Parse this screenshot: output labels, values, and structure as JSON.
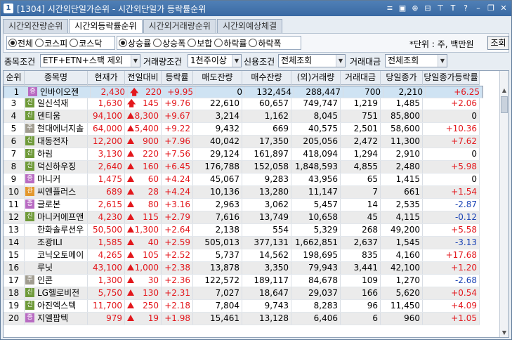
{
  "window": {
    "number": "1",
    "title": "[1304] 시간외단일가순위 - 시간외단일가 등락률순위"
  },
  "title_icons": [
    "menu-icon",
    "screen-icon",
    "zoom-icon",
    "minimize-icon",
    "pin-icon",
    "text-icon",
    "help-icon",
    "window-minimize-icon",
    "restore-icon",
    "close-icon"
  ],
  "tabs": [
    {
      "label": "시간외잔량순위",
      "active": false
    },
    {
      "label": "시간외등락률순위",
      "active": true
    },
    {
      "label": "시간외거래량순위",
      "active": false
    },
    {
      "label": "시간외예상체결",
      "active": false
    }
  ],
  "market_filter": [
    {
      "label": "전체",
      "checked": true
    },
    {
      "label": "코스피",
      "checked": false
    },
    {
      "label": "코스닥",
      "checked": false
    }
  ],
  "rank_filter": [
    {
      "label": "상승률",
      "checked": true
    },
    {
      "label": "상승폭",
      "checked": false
    },
    {
      "label": "보합",
      "checked": false
    },
    {
      "label": "하락률",
      "checked": false
    },
    {
      "label": "하락폭",
      "checked": false
    }
  ],
  "unit_text": "*단위 : 주, 백만원",
  "query_button": "조회",
  "conditions": {
    "item_label": "종목조건",
    "item_value": "ETF+ETN+스팩 제외",
    "volume_label": "거래량조건",
    "volume_value": "1천주이상",
    "credit_label": "신용조건",
    "credit_value": "전체조회",
    "amount_label": "거래대금",
    "amount_value": "전체조회"
  },
  "columns": [
    "순위",
    "종목명",
    "현재가",
    "전일대비",
    "등락률",
    "매도잔량",
    "매수잔량",
    "(외)거래량",
    "거래대금",
    "당일종가",
    "당일종가등락률"
  ],
  "rows": [
    {
      "rank": "1",
      "badge": "증",
      "badge_color": "#b86bc2",
      "name": "인바이오젠",
      "price": "2,430",
      "sign": "arrow",
      "change": "220",
      "rate": "+9.95",
      "ask": "0",
      "bid": "132,454",
      "volume": "288,447",
      "amount": "700",
      "close": "2,210",
      "close_rate": "+6.25"
    },
    {
      "rank": "2",
      "badge": "",
      "badge_color": "",
      "name": "제노포커스",
      "price": "7,020",
      "sign": "arrow",
      "change": "630",
      "rate": "+9.86",
      "ask": "0",
      "bid": "400,511",
      "volume": "48,325",
      "amount": "339",
      "close": "6,390",
      "close_rate": "+5.45"
    },
    {
      "rank": "3",
      "badge": "신",
      "badge_color": "#6f9a3a",
      "name": "일신석재",
      "price": "1,630",
      "sign": "arrow",
      "change": "145",
      "rate": "+9.76",
      "ask": "22,610",
      "bid": "60,657",
      "volume": "749,747",
      "amount": "1,219",
      "close": "1,485",
      "close_rate": "+2.06"
    },
    {
      "rank": "4",
      "badge": "신",
      "badge_color": "#6f9a3a",
      "name": "덴티움",
      "price": "94,100",
      "sign": "tri",
      "change": "8,300",
      "rate": "+9.67",
      "ask": "3,214",
      "bid": "1,162",
      "volume": "8,045",
      "amount": "751",
      "close": "85,800",
      "close_rate": "0"
    },
    {
      "rank": "5",
      "badge": "주",
      "badge_color": "#a09c90",
      "name": "현대에너지솔",
      "price": "64,000",
      "sign": "tri",
      "change": "5,400",
      "rate": "+9.22",
      "ask": "9,432",
      "bid": "669",
      "volume": "40,575",
      "amount": "2,501",
      "close": "58,600",
      "close_rate": "+10.36"
    },
    {
      "rank": "6",
      "badge": "신",
      "badge_color": "#6f9a3a",
      "name": "대동전자",
      "price": "12,200",
      "sign": "tri",
      "change": "900",
      "rate": "+7.96",
      "ask": "40,042",
      "bid": "17,350",
      "volume": "205,056",
      "amount": "2,472",
      "close": "11,300",
      "close_rate": "+7.62"
    },
    {
      "rank": "7",
      "badge": "신",
      "badge_color": "#6f9a3a",
      "name": "하림",
      "price": "3,130",
      "sign": "tri",
      "change": "220",
      "rate": "+7.56",
      "ask": "29,124",
      "bid": "161,897",
      "volume": "418,094",
      "amount": "1,294",
      "close": "2,910",
      "close_rate": "0"
    },
    {
      "rank": "8",
      "badge": "신",
      "badge_color": "#6f9a3a",
      "name": "덕신하우징",
      "price": "2,640",
      "sign": "tri",
      "change": "160",
      "rate": "+6.45",
      "ask": "176,788",
      "bid": "152,058",
      "volume": "1,848,593",
      "amount": "4,855",
      "close": "2,480",
      "close_rate": "+5.98"
    },
    {
      "rank": "9",
      "badge": "증",
      "badge_color": "#b86bc2",
      "name": "마니커",
      "price": "1,475",
      "sign": "tri",
      "change": "60",
      "rate": "+4.24",
      "ask": "45,067",
      "bid": "9,283",
      "volume": "43,956",
      "amount": "65",
      "close": "1,415",
      "close_rate": "0"
    },
    {
      "rank": "10",
      "badge": "관",
      "badge_color": "#e3972d",
      "name": "씨엔플러스",
      "price": "689",
      "sign": "tri",
      "change": "28",
      "rate": "+4.24",
      "ask": "10,136",
      "bid": "13,280",
      "volume": "11,147",
      "amount": "7",
      "close": "661",
      "close_rate": "+1.54"
    },
    {
      "rank": "11",
      "badge": "증",
      "badge_color": "#b86bc2",
      "name": "글로본",
      "price": "2,615",
      "sign": "tri",
      "change": "80",
      "rate": "+3.16",
      "ask": "2,963",
      "bid": "3,062",
      "volume": "5,457",
      "amount": "14",
      "close": "2,535",
      "close_rate": "-2.87"
    },
    {
      "rank": "12",
      "badge": "신",
      "badge_color": "#6f9a3a",
      "name": "마니커에프앤",
      "price": "4,230",
      "sign": "tri",
      "change": "115",
      "rate": "+2.79",
      "ask": "7,616",
      "bid": "13,749",
      "volume": "10,658",
      "amount": "45",
      "close": "4,115",
      "close_rate": "-0.12"
    },
    {
      "rank": "13",
      "badge": "",
      "badge_color": "",
      "name": "한화솔루션우",
      "price": "50,500",
      "sign": "tri",
      "change": "1,300",
      "rate": "+2.64",
      "ask": "2,138",
      "bid": "554",
      "volume": "5,329",
      "amount": "268",
      "close": "49,200",
      "close_rate": "+5.58"
    },
    {
      "rank": "14",
      "badge": "",
      "badge_color": "",
      "name": "조광ILI",
      "price": "1,585",
      "sign": "tri",
      "change": "40",
      "rate": "+2.59",
      "ask": "505,013",
      "bid": "377,131",
      "volume": "1,662,851",
      "amount": "2,637",
      "close": "1,545",
      "close_rate": "-3.13"
    },
    {
      "rank": "15",
      "badge": "",
      "badge_color": "",
      "name": "코닉오토메이",
      "price": "4,265",
      "sign": "tri",
      "change": "105",
      "rate": "+2.52",
      "ask": "5,737",
      "bid": "14,562",
      "volume": "198,695",
      "amount": "835",
      "close": "4,160",
      "close_rate": "+17.68"
    },
    {
      "rank": "16",
      "badge": "",
      "badge_color": "",
      "name": "루닛",
      "price": "43,100",
      "sign": "tri",
      "change": "1,000",
      "rate": "+2.38",
      "ask": "13,878",
      "bid": "3,350",
      "volume": "79,943",
      "amount": "3,441",
      "close": "42,100",
      "close_rate": "+1.20"
    },
    {
      "rank": "17",
      "badge": "주",
      "badge_color": "#a09c90",
      "name": "인콘",
      "price": "1,300",
      "sign": "tri",
      "change": "30",
      "rate": "+2.36",
      "ask": "122,572",
      "bid": "189,117",
      "volume": "84,678",
      "amount": "109",
      "close": "1,270",
      "close_rate": "-2.68"
    },
    {
      "rank": "18",
      "badge": "신",
      "badge_color": "#6f9a3a",
      "name": "LG헬로비전",
      "price": "5,750",
      "sign": "tri",
      "change": "130",
      "rate": "+2.31",
      "ask": "7,027",
      "bid": "18,647",
      "volume": "29,037",
      "amount": "166",
      "close": "5,620",
      "close_rate": "+0.54"
    },
    {
      "rank": "19",
      "badge": "신",
      "badge_color": "#6f9a3a",
      "name": "아진엑스텍",
      "price": "11,700",
      "sign": "tri",
      "change": "250",
      "rate": "+2.18",
      "ask": "7,804",
      "bid": "9,743",
      "volume": "8,283",
      "amount": "96",
      "close": "11,450",
      "close_rate": "+4.09"
    },
    {
      "rank": "20",
      "badge": "증",
      "badge_color": "#b86bc2",
      "name": "지엘팜텍",
      "price": "979",
      "sign": "tri",
      "change": "19",
      "rate": "+1.98",
      "ask": "15,461",
      "bid": "13,128",
      "volume": "6,406",
      "amount": "6",
      "close": "960",
      "close_rate": "+1.05"
    }
  ]
}
